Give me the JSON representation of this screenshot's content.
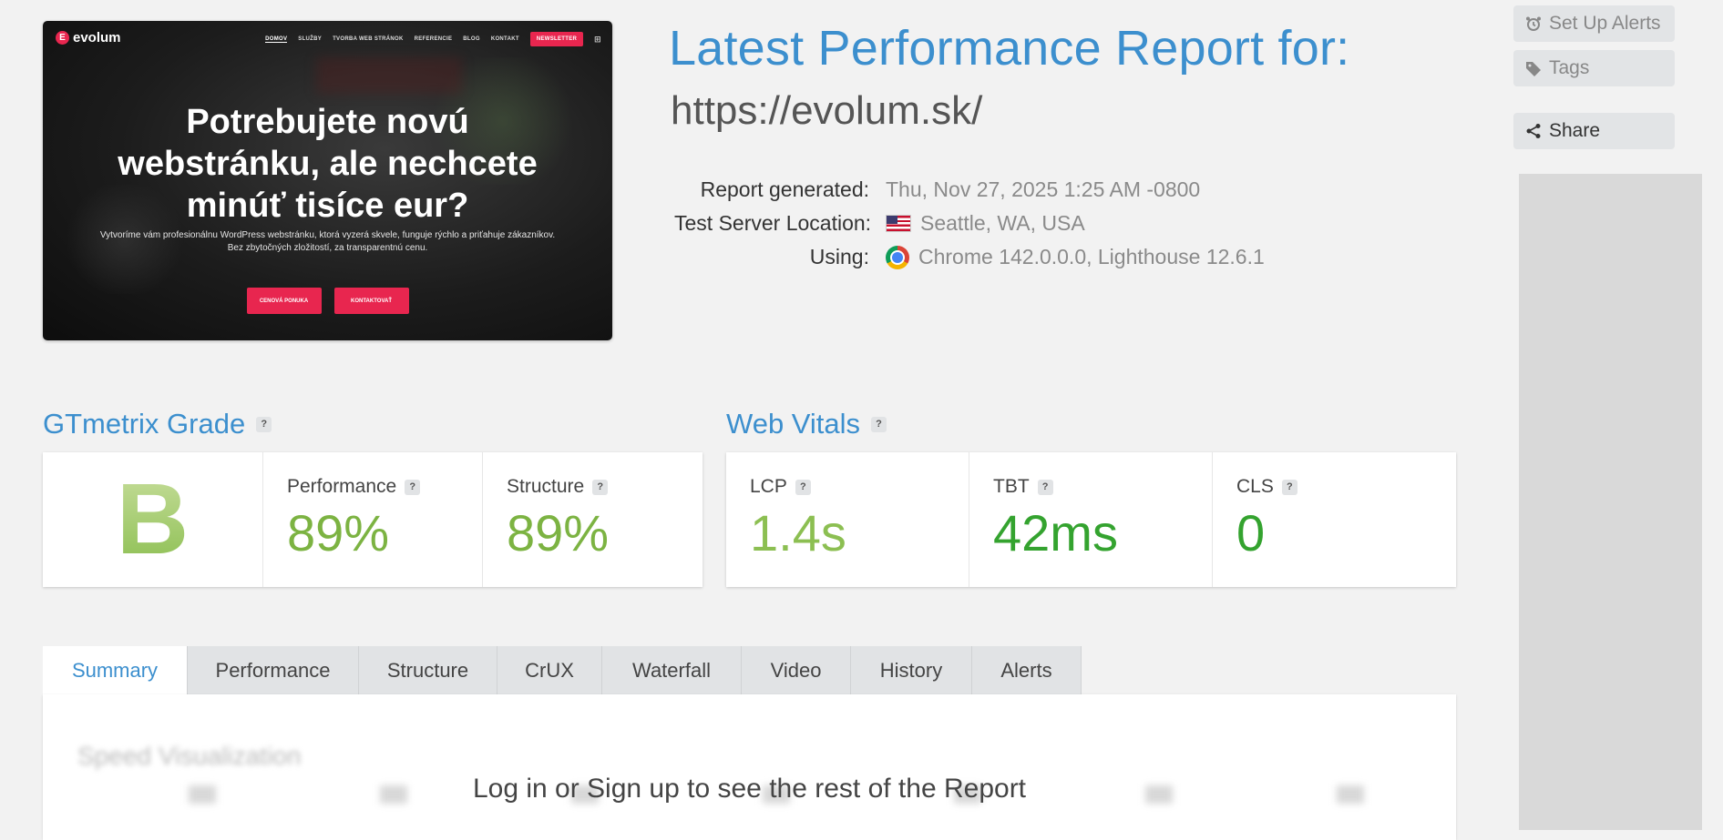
{
  "thumbnail": {
    "logo": "evolum",
    "logo_mark": "E",
    "nav": [
      "DOMOV",
      "SLUŽBY",
      "TVORBA WEB STRÁNOK",
      "REFERENCIE",
      "BLOG",
      "KONTAKT"
    ],
    "nav_cta": "NEWSLETTER",
    "headline_1": "Potrebujete novú",
    "headline_2": "webstránku, ale nechcete",
    "headline_3": "minúť tisíce eur?",
    "subtext_1": "Vytvoríme vám profesionálnu WordPress webstránku, ktorá vyzerá skvele, funguje rýchlo a priťahuje zákazníkov.",
    "subtext_2": "Bez zbytočných zložitostí, za transparentnú cenu.",
    "button_1": "CENOVÁ PONUKA",
    "button_2": "KONTAKTOVAŤ"
  },
  "report": {
    "title": "Latest Performance Report for:",
    "url": "https://evolum.sk/",
    "generated_label": "Report generated:",
    "generated_value": "Thu, Nov 27, 2025 1:25 AM -0800",
    "location_label": "Test Server Location:",
    "location_value": "Seattle, WA, USA",
    "using_label": "Using:",
    "using_value": "Chrome 142.0.0.0, Lighthouse 12.6.1"
  },
  "sidebar": {
    "alerts": "Set Up Alerts",
    "tags": "Tags",
    "share": "Share"
  },
  "grade": {
    "heading": "GTmetrix Grade",
    "help": "?",
    "letter": "B",
    "performance_label": "Performance",
    "performance_value": "89%",
    "structure_label": "Structure",
    "structure_value": "89%"
  },
  "vitals": {
    "heading": "Web Vitals",
    "help": "?",
    "lcp_label": "LCP",
    "lcp_value": "1.4s",
    "tbt_label": "TBT",
    "tbt_value": "42ms",
    "cls_label": "CLS",
    "cls_value": "0"
  },
  "tabs": [
    "Summary",
    "Performance",
    "Structure",
    "CrUX",
    "Waterfall",
    "Video",
    "History",
    "Alerts"
  ],
  "panel": {
    "blurred_heading": "Speed Visualization",
    "login_message": "Log in or Sign up to see the rest of the Report"
  },
  "colors": {
    "accent": "#3c8fce",
    "grade_green": "#8cbf52",
    "vital_green": "#34a32f",
    "cta_red": "#e8264f"
  }
}
